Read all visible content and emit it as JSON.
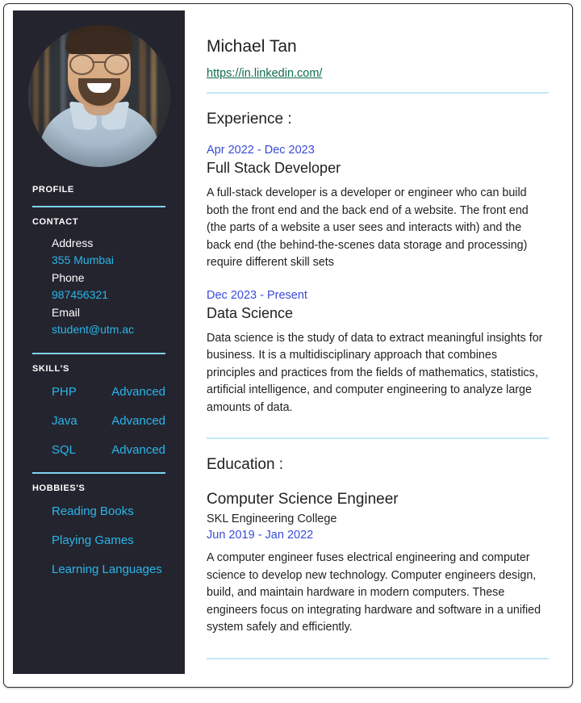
{
  "document": {
    "type": "resume",
    "accent_cyan": "#29b6e8",
    "sidebar_bg": "#24242f",
    "rule_color": "#bfeaf5",
    "date_color": "#3a4bd8",
    "link_color": "#116b4e"
  },
  "sidebar": {
    "avatar": {
      "alt": "profile-photo",
      "description": "smiling man with glasses in light blue shirt in front of bookshelf"
    },
    "profile_label": "PROFILE",
    "contact_label": "CONTACT",
    "contact": [
      {
        "key": "Address",
        "value": "355 Mumbai"
      },
      {
        "key": "Phone",
        "value": "987456321"
      },
      {
        "key": "Email",
        "value": "student@utm.ac"
      }
    ],
    "skills_label": "SKILL'S",
    "skills": [
      {
        "name": "PHP",
        "level": "Advanced"
      },
      {
        "name": "Java",
        "level": "Advanced"
      },
      {
        "name": "SQL",
        "level": "Advanced"
      }
    ],
    "hobbies_label": "HOBBIES'S",
    "hobbies": [
      "Reading Books",
      "Playing Games",
      "Learning Languages"
    ]
  },
  "main": {
    "name": "Michael Tan",
    "profile_url": "https://in.linkedin.com/",
    "experience_title": "Experience :",
    "experience": [
      {
        "date": "Apr 2022 - Dec 2023",
        "title": "Full Stack Developer",
        "body": "A full-stack developer is a developer or engineer who can build both the front end and the back end of a website. The front end (the parts of a website a user sees and interacts with) and the back end (the behind-the-scenes data storage and processing) require different skill sets"
      },
      {
        "date": "Dec 2023 - Present",
        "title": "Data Science",
        "body": "Data science is the study of data to extract meaningful insights for business. It is a multidisciplinary approach that combines principles and practices from the fields of mathematics, statistics, artificial intelligence, and computer engineering to analyze large amounts of data."
      }
    ],
    "education_title": "Education :",
    "education": [
      {
        "title": "Computer Science Engineer",
        "institution": "SKL Engineering College",
        "date": "Jun 2019 - Jan 2022",
        "body": "A computer engineer fuses electrical engineering and computer science to develop new technology. Computer engineers design, build, and maintain hardware in modern computers. These engineers focus on integrating hardware and software in a unified system safely and efficiently."
      }
    ]
  }
}
